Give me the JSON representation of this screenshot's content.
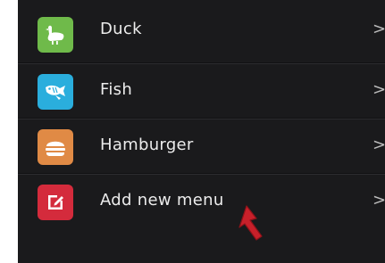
{
  "menu": {
    "items": [
      {
        "label": "Duck",
        "icon": "duck-icon",
        "color": "#6fba4a",
        "chevron": ">"
      },
      {
        "label": "Fish",
        "icon": "fish-icon",
        "color": "#2aaedd",
        "chevron": ">"
      },
      {
        "label": "Hamburger",
        "icon": "hamburger-icon",
        "color": "#e08a45",
        "chevron": ">"
      },
      {
        "label": "Add new menu",
        "icon": "edit-icon",
        "color": "#d42b3c",
        "chevron": ">"
      }
    ]
  },
  "cursor": {
    "icon": "arrow-cursor-icon",
    "color": "#c8202a"
  }
}
